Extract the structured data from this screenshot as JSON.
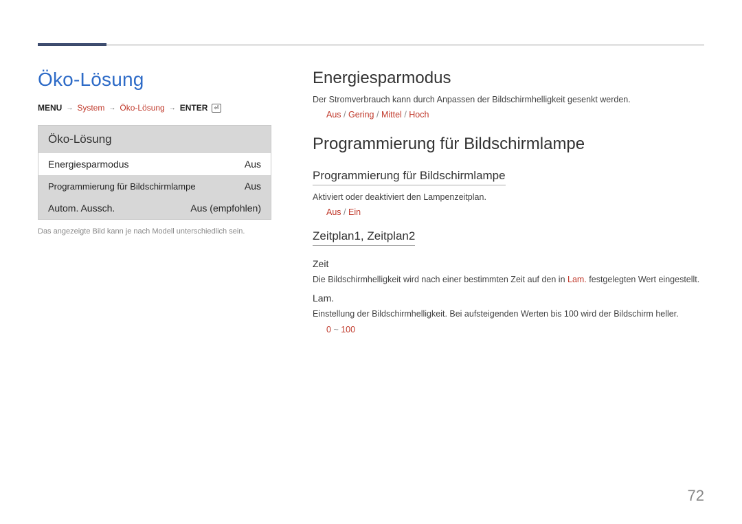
{
  "page_number": "72",
  "left": {
    "title": "Öko-Lösung",
    "breadcrumb": {
      "menu": "MENU",
      "system": "System",
      "eco": "Öko-Lösung",
      "enter": "ENTER"
    },
    "osd": {
      "title": "Öko-Lösung",
      "rows": [
        {
          "label": "Energiesparmodus",
          "value": "Aus"
        },
        {
          "label": "Programmierung für Bildschirmlampe",
          "value": "Aus"
        },
        {
          "label": "Autom. Aussch.",
          "value": "Aus (empfohlen)"
        }
      ]
    },
    "image_note": "Das angezeigte Bild kann je nach Modell unterschiedlich sein."
  },
  "right": {
    "section1": {
      "title": "Energiesparmodus",
      "desc": "Der Stromverbrauch kann durch Anpassen der Bildschirmhelligkeit gesenkt werden.",
      "options": [
        "Aus",
        "Gering",
        "Mittel",
        "Hoch"
      ]
    },
    "section2": {
      "title": "Programmierung für Bildschirmlampe",
      "sub1": {
        "title": "Programmierung für Bildschirmlampe",
        "desc": "Aktiviert oder deaktiviert den Lampenzeitplan.",
        "options": [
          "Aus",
          "Ein"
        ]
      },
      "sub2": {
        "title": "Zeitplan1, Zeitplan2",
        "zeit": {
          "title": "Zeit",
          "desc_pre": "Die Bildschirmhelligkeit wird nach einer bestimmten Zeit auf den in ",
          "desc_red": "Lam.",
          "desc_post": " festgelegten Wert eingestellt."
        },
        "lam": {
          "title": "Lam.",
          "desc": "Einstellung der Bildschirmhelligkeit. Bei aufsteigenden Werten bis 100 wird der Bildschirm heller.",
          "options_pre": "0",
          "options_sep": "~",
          "options_post": "100"
        }
      }
    }
  }
}
